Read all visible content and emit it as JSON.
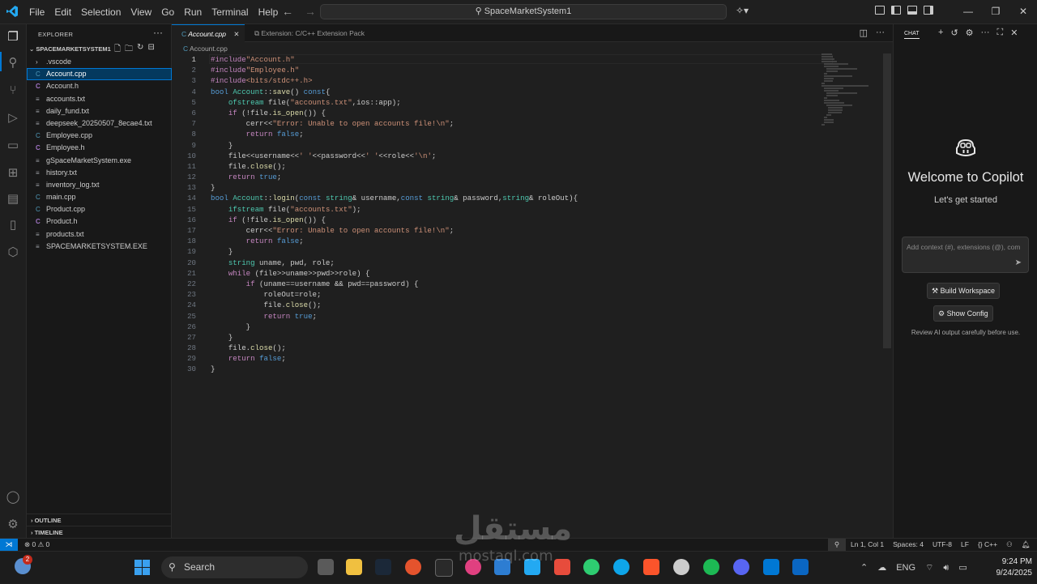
{
  "menu": [
    "File",
    "Edit",
    "Selection",
    "View",
    "Go",
    "Run",
    "Terminal",
    "Help"
  ],
  "command_center": "SpaceMarketSystem1",
  "explorer": {
    "title": "EXPLORER",
    "project": "SPACEMARKETSYSTEM1",
    "items": [
      {
        "label": ".vscode",
        "type": "folder"
      },
      {
        "label": "Account.cpp",
        "type": "cpp",
        "selected": true
      },
      {
        "label": "Account.h",
        "type": "h"
      },
      {
        "label": "accounts.txt",
        "type": "txt"
      },
      {
        "label": "daily_fund.txt",
        "type": "txt"
      },
      {
        "label": "deepseek_20250507_8ecae4.txt",
        "type": "txt"
      },
      {
        "label": "Employee.cpp",
        "type": "cpp"
      },
      {
        "label": "Employee.h",
        "type": "h"
      },
      {
        "label": "gSpaceMarketSystem.exe",
        "type": "txt"
      },
      {
        "label": "history.txt",
        "type": "txt"
      },
      {
        "label": "inventory_log.txt",
        "type": "txt"
      },
      {
        "label": "main.cpp",
        "type": "cpp"
      },
      {
        "label": "Product.cpp",
        "type": "cpp"
      },
      {
        "label": "Product.h",
        "type": "h"
      },
      {
        "label": "products.txt",
        "type": "txt"
      },
      {
        "label": "SPACEMARKETSYSTEM.EXE",
        "type": "txt"
      }
    ],
    "outline": "OUTLINE",
    "timeline": "TIMELINE"
  },
  "tabs": [
    {
      "label": "Account.cpp",
      "active": true
    },
    {
      "label": "Extension: C/C++ Extension Pack",
      "active": false
    }
  ],
  "breadcrumb": "Account.cpp",
  "code_lines": [
    "#include\"Account.h\"",
    "#include\"Employee.h\"",
    "#include<bits/stdc++.h>",
    "bool Account::save() const{",
    "    ofstream file(\"accounts.txt\",ios::app);",
    "    if (!file.is_open()) {",
    "        cerr<<\"Error: Unable to open accounts file!\\n\";",
    "        return false;",
    "    }",
    "    file<<username<<' '<<password<<' '<<role<<'\\n';",
    "    file.close();",
    "    return true;",
    "}",
    "bool Account::login(const string& username,const string& password,string& roleOut){",
    "    ifstream file(\"accounts.txt\");",
    "    if (!file.is_open()) {",
    "        cerr<<\"Error: Unable to open accounts file!\\n\";",
    "        return false;",
    "    }",
    "    string uname, pwd, role;",
    "    while (file>>uname>>pwd>>role) {",
    "        if (uname==username && pwd==password) {",
    "            roleOut=role;",
    "            file.close();",
    "            return true;",
    "        }",
    "    }",
    "    file.close();",
    "    return false;",
    "}"
  ],
  "chat": {
    "tab": "CHAT",
    "welcome": "Welcome to Copilot",
    "subtitle": "Let's get started",
    "input_placeholder": "Add context (#), extensions (@), com",
    "build_workspace": "Build Workspace",
    "show_config": "Show Config",
    "review_note": "Review AI output carefully before use."
  },
  "status": {
    "problems": "⊗ 0 ⚠ 0",
    "position": "Ln 1, Col 1",
    "spaces": "Spaces: 4",
    "encoding": "UTF-8",
    "eol": "LF",
    "language": "C++"
  },
  "taskbar": {
    "search": "Search",
    "notification_count": "2",
    "lang": "ENG",
    "time": "9:24 PM",
    "date": "9/24/2025"
  },
  "watermark": {
    "arabic": "مستقل",
    "latin": "mostaql.com"
  },
  "colors": {
    "accent": "#0078d4",
    "selection": "#04395e",
    "editor_bg": "#1f1f1f",
    "sidebar_bg": "#181818"
  }
}
